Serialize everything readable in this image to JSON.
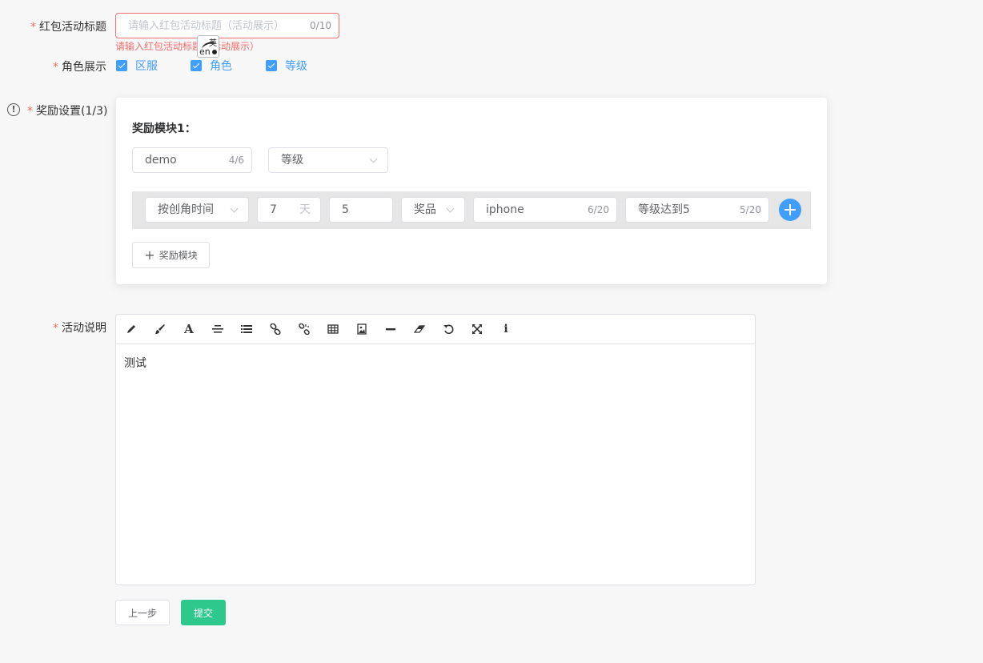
{
  "form": {
    "title_field": {
      "label": "红包活动标题",
      "required_mark": "*",
      "placeholder": "请输入红包活动标题（活动展示）",
      "value": "",
      "counter": "0/10",
      "error": "请输入红包活动标题（活动展示）"
    },
    "ime_indicator": {
      "cn": "英",
      "en": "en"
    },
    "role_display": {
      "label": "角色展示",
      "required_mark": "*",
      "options": [
        {
          "label": "区服",
          "checked": true
        },
        {
          "label": "角色",
          "checked": true
        },
        {
          "label": "等级",
          "checked": true
        }
      ]
    },
    "reward_settings": {
      "label": "奖励设置(1/3)",
      "required_mark": "*",
      "info_icon": "!",
      "modules": [
        {
          "title": "奖励模块1：",
          "name_value": "demo",
          "name_counter": "4/6",
          "type_select": "等级",
          "rows": [
            {
              "condition_select": "按创角时间",
              "days_value": "7",
              "days_suffix": "天",
              "amount_value": "5",
              "prize_select": "奖品",
              "prize_value": "iphone",
              "prize_counter": "6/20",
              "desc_value": "等级达到5",
              "desc_counter": "5/20"
            }
          ]
        }
      ],
      "add_module_label": "奖励模块"
    },
    "description": {
      "label": "活动说明",
      "required_mark": "*",
      "toolbar_icons": [
        "pencil-icon",
        "brush-icon",
        "font-icon",
        "align-center-icon",
        "list-icon",
        "link-icon",
        "unlink-icon",
        "table-icon",
        "image-icon",
        "horizontal-rule-icon",
        "eraser-icon",
        "undo-icon",
        "fullscreen-icon",
        "info-icon"
      ],
      "content": "测试"
    },
    "buttons": {
      "prev_label": "上一步",
      "submit_label": "提交"
    }
  },
  "colors": {
    "primary": "#409eff",
    "error": "#f56c6c",
    "submit": "#2ec88c"
  }
}
